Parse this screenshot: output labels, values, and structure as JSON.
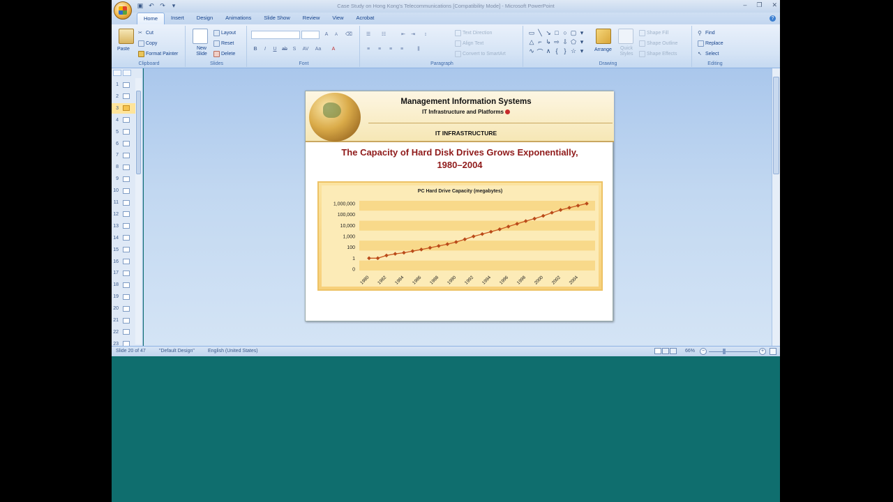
{
  "window": {
    "title": "Case Study on Hong Kong's Telecommunications [Compatibility Mode] - Microsoft PowerPoint"
  },
  "ribbon_tabs": [
    "Home",
    "Insert",
    "Design",
    "Animations",
    "Slide Show",
    "Review",
    "View",
    "Acrobat"
  ],
  "ribbon": {
    "clipboard": {
      "paste": "Paste",
      "cut": "Cut",
      "copy": "Copy",
      "format_painter": "Format Painter",
      "label": "Clipboard"
    },
    "slides": {
      "new_slide": "New Slide",
      "layout": "Layout",
      "reset": "Reset",
      "delete": "Delete",
      "label": "Slides"
    },
    "font": {
      "label": "Font"
    },
    "paragraph": {
      "text_direction": "Text Direction",
      "align_text": "Align Text",
      "convert": "Convert to SmartArt",
      "label": "Paragraph"
    },
    "drawing": {
      "arrange": "Arrange",
      "quick_styles": "Quick Styles",
      "shape_fill": "Shape Fill",
      "shape_outline": "Shape Outline",
      "shape_effects": "Shape Effects",
      "label": "Drawing"
    },
    "editing": {
      "find": "Find",
      "replace": "Replace",
      "select": "Select",
      "label": "Editing"
    }
  },
  "slide_panel": {
    "numbers": [
      "1",
      "2",
      "3",
      "4",
      "5",
      "6",
      "7",
      "8",
      "9",
      "10",
      "11",
      "12",
      "13",
      "14",
      "15",
      "16",
      "17",
      "18",
      "19",
      "20",
      "21",
      "22",
      "23"
    ],
    "selected": "3"
  },
  "slide": {
    "header_title": "Management Information Systems",
    "header_subtitle": "IT Infrastructure and Platforms",
    "section": "IT INFRASTRUCTURE",
    "title_line1": "The Capacity of Hard Disk Drives Grows Exponentially,",
    "title_line2": "1980–2004"
  },
  "chart_data": {
    "type": "line",
    "title": "PC Hard Drive Capacity (megabytes)",
    "xlabel": "",
    "ylabel": "",
    "y_scale": "log",
    "y_ticks": [
      "1,000,000",
      "100,000",
      "10,000",
      "1,000",
      "100",
      "1",
      "0"
    ],
    "x_ticks": [
      "1980",
      "1982",
      "1984",
      "1986",
      "1988",
      "1990",
      "1992",
      "1994",
      "1996",
      "1998",
      "2000",
      "2002",
      "2004"
    ],
    "x": [
      1980,
      1981,
      1982,
      1983,
      1984,
      1985,
      1986,
      1987,
      1988,
      1989,
      1990,
      1991,
      1992,
      1993,
      1994,
      1995,
      1996,
      1997,
      1998,
      1999,
      2000,
      2001,
      2002,
      2003,
      2004,
      2005
    ],
    "values": [
      1,
      1,
      2,
      3,
      4,
      6,
      9,
      14,
      22,
      35,
      60,
      120,
      250,
      450,
      800,
      1500,
      3000,
      6000,
      12000,
      22000,
      45000,
      100000,
      200000,
      350000,
      600000,
      1000000
    ],
    "colors": {
      "line": "#c8561e",
      "marker": "#b94a1a",
      "band_light": "#fcebb7",
      "band_dark": "#f8d98a"
    },
    "grid": true
  },
  "statusbar": {
    "slide_info": "Slide 20 of 47",
    "theme": "\"Default Design\"",
    "language": "English (United States)",
    "zoom": "66%"
  }
}
